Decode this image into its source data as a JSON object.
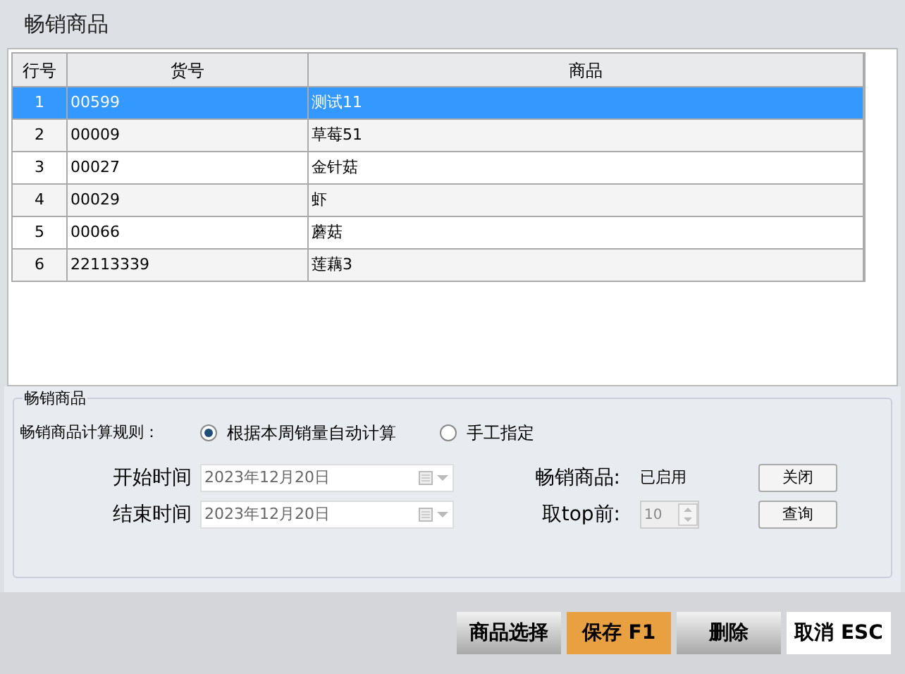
{
  "window": {
    "title": "畅销商品"
  },
  "table": {
    "columns": [
      "行号",
      "货号",
      "商品"
    ],
    "rows": [
      {
        "cells": [
          "1",
          "00599",
          "测试11"
        ],
        "selected": true
      },
      {
        "cells": [
          "2",
          "00009",
          "草莓51"
        ],
        "selected": false
      },
      {
        "cells": [
          "3",
          "00027",
          "金针菇"
        ],
        "selected": false
      },
      {
        "cells": [
          "4",
          "00029",
          "虾"
        ],
        "selected": false
      },
      {
        "cells": [
          "5",
          "00066",
          "蘑菇"
        ],
        "selected": false
      },
      {
        "cells": [
          "6",
          "22113339",
          "莲藕3"
        ],
        "selected": false
      }
    ]
  },
  "group": {
    "legend": "畅销商品",
    "rule_label": "畅销商品计算规则：",
    "rule_options": [
      {
        "label": "根据本周销量自动计算",
        "selected": true
      },
      {
        "label": "手工指定",
        "selected": false
      }
    ],
    "start_label": "开始时间",
    "start_value": "2023年12月20日",
    "end_label": "结束时间",
    "end_value": "2023年12月20日",
    "status_label": "畅销商品:",
    "status_value": "已启用",
    "status_button": "关闭",
    "top_label": "取top前:",
    "top_value": "10",
    "query_button": "查询"
  },
  "buttons": [
    {
      "label": "商品选择",
      "kind": "normal"
    },
    {
      "label": "保存 F1",
      "kind": "primary"
    },
    {
      "label": "删除",
      "kind": "normal"
    },
    {
      "label": "取消 ESC",
      "kind": "plain"
    }
  ]
}
